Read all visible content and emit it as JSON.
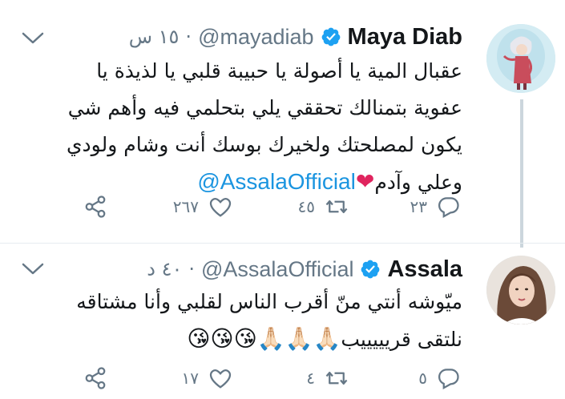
{
  "tweets": [
    {
      "author": "Maya Diab",
      "handle": "@mayadiab",
      "time": "١٥ س",
      "text_lines": [
        "عقبال المية يا أصولة يا حبيبة قلبي يا لذيذة يا",
        "عفوية بتمنالك تحققي يلي بتحلمي فيه وأهم شي",
        "يكون لمصلحتك ولخيرك  بوسك أنت وشام ولودي",
        "وعلي وآدم"
      ],
      "mention": "@AssalaOfficial",
      "emoji": "❤",
      "reply_count": "٢٣",
      "retweet_count": "٤٥",
      "like_count": "٢٦٧"
    },
    {
      "author": "Assala",
      "handle": "@AssalaOfficial",
      "time": "٤٠ د",
      "text_lines": [
        "ميّوشه أنتي منّ أقرب الناس لقلبي وأنا مشتاقه",
        "نلتقى قريييييب"
      ],
      "emoji": "🙏🏻🙏🏻🙏🏻😘😘😘",
      "reply_count": "٥",
      "retweet_count": "٤",
      "like_count": "١٧"
    }
  ],
  "icons": {
    "verified": "verified-badge-icon",
    "more": "chevron-down-icon",
    "reply": "reply-icon",
    "retweet": "retweet-icon",
    "like": "heart-icon",
    "share": "share-icon"
  },
  "colors": {
    "link": "#1b95e0",
    "verified": "#1da1f2",
    "muted": "#657786",
    "heart_emoji": "#e0245e"
  }
}
